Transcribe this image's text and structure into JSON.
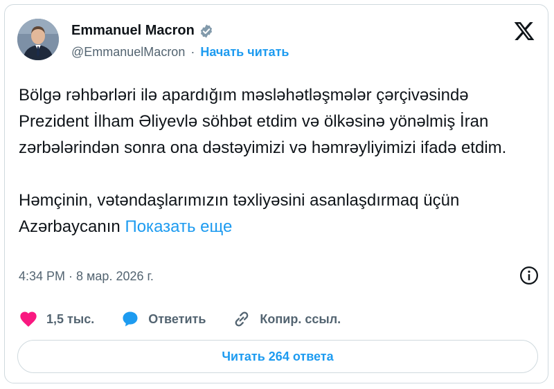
{
  "author": {
    "name": "Emmanuel Macron",
    "handle": "@EmmanuelMacron",
    "follow_label": "Начать читать",
    "separator": "·",
    "verified_icon": "verified-badge-icon"
  },
  "tweet": {
    "paragraph1": "Bölgə rəhbərləri ilə apardığım məsləhətləşmələr çərçivəsində Prezident İlham Əliyevlə söhbət etdim və ölkəsinə yönəlmiş İran zərbələrindən sonra ona dəstəyimizi və həmrəyliyimizi ifadə etdim.",
    "paragraph2": "Həmçinin, vətəndaşlarımızın təxliyəsini asanlaşdırmaq üçün Azərbaycanın",
    "show_more": "Показать еще",
    "timestamp": "4:34 PM · 8 мар. 2026 г."
  },
  "actions": {
    "likes": "1,5 тыс.",
    "reply": "Ответить",
    "copy_link": "Копир. ссыл."
  },
  "replies_button": "Читать 264 ответа",
  "colors": {
    "accent": "#1d9bf0",
    "like": "#f91880",
    "text": "#0f1419",
    "muted": "#536471",
    "border": "#cfd9de"
  }
}
